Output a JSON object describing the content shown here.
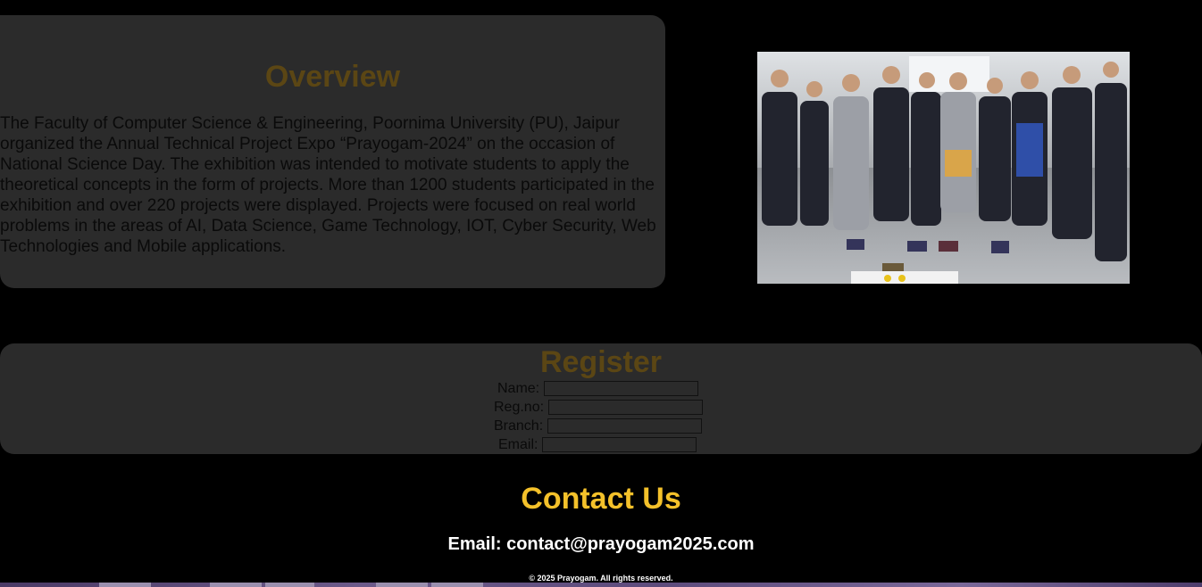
{
  "overview": {
    "title": "Overview",
    "text": "The Faculty of Computer Science & Engineering, Poornima University (PU), Jaipur organized the Annual Technical Project Expo “Prayogam-2024” on the occasion of National Science Day. The exhibition was intended to motivate students to apply the theoretical concepts in the form of projects. More than 1200 students participated in the exhibition and over 220 projects were displayed. Projects were focused on real world problems in the areas of AI, Data Science, Game Technology, IOT, Cyber Security, Web Technologies and Mobile applications."
  },
  "photo": {
    "alt": "Students and faculty observing robotic car projects at the expo"
  },
  "register": {
    "title": "Register",
    "fields": [
      {
        "label": "Name:",
        "value": ""
      },
      {
        "label": "Reg.no:",
        "value": ""
      },
      {
        "label": "Branch:",
        "value": ""
      },
      {
        "label": "Email:",
        "value": ""
      }
    ]
  },
  "contact": {
    "title": "Contact Us",
    "email": "Email: contact@prayogam2025.com"
  },
  "footer": {
    "copyright": "© 2025 Prayogam. All rights reserved."
  },
  "colors": {
    "background": "#000000",
    "card": "#2b2b2b",
    "heading_dim": "#5b4614",
    "accent": "#f4c12a",
    "text_light": "#ffffff"
  }
}
